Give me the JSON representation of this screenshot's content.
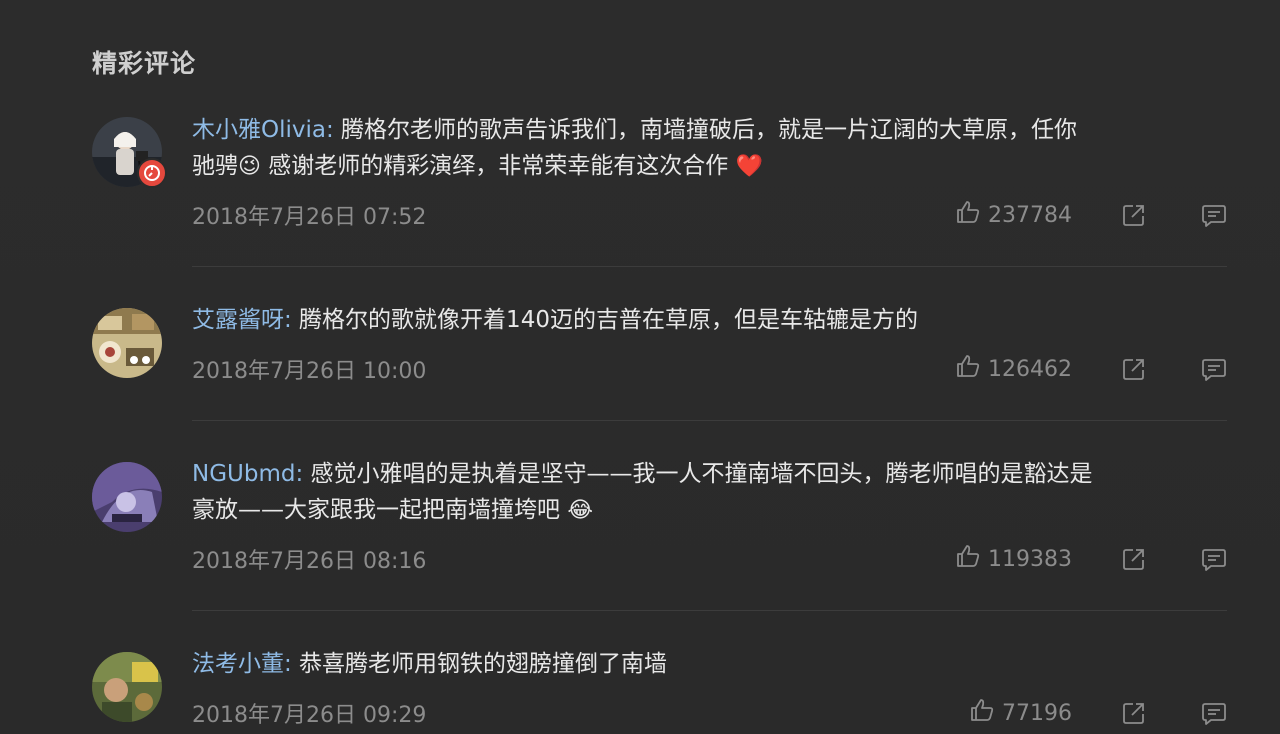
{
  "section": {
    "title": "精彩评论"
  },
  "comments": [
    {
      "username": "木小雅Olivia:",
      "text_1": " 腾格尔老师的歌声告诉我们，南墙撞破后，就是一片辽阔的大草原，任你",
      "text_2": "驰骋",
      "emoji_1": "😉",
      "text_3": " 感谢老师的精彩演绎，非常荣幸能有这次合作 ",
      "emoji_2": "❤️",
      "date": "2018年7月26日 07:52",
      "likes": "237784"
    },
    {
      "username": "艾露酱呀:",
      "text_1": " 腾格尔的歌就像开着140迈的吉普在草原，但是车轱辘是方的",
      "date": "2018年7月26日 10:00",
      "likes": "126462"
    },
    {
      "username": "NGUbmd:",
      "text_1": " 感觉小雅唱的是执着是坚守——我一人不撞南墙不回头，腾老师唱的是豁达是",
      "text_2": "豪放——大家跟我一起把南墙撞垮吧 ",
      "emoji_1": "😂",
      "date": "2018年7月26日 08:16",
      "likes": "119383"
    },
    {
      "username": "法考小董:",
      "text_1": " 恭喜腾老师用钢铁的翅膀撞倒了南墙",
      "date": "2018年7月26日 09:29",
      "likes": "77196"
    }
  ],
  "icons": {
    "like": "thumbs-up-icon",
    "share": "share-icon",
    "reply": "comment-icon",
    "badge": "verified-badge-icon"
  },
  "colors": {
    "background": "#2b2b2b",
    "username": "#8fbbe6",
    "text": "#e8e8e8",
    "meta": "#8c8c8c",
    "badge": "#e5483d"
  }
}
